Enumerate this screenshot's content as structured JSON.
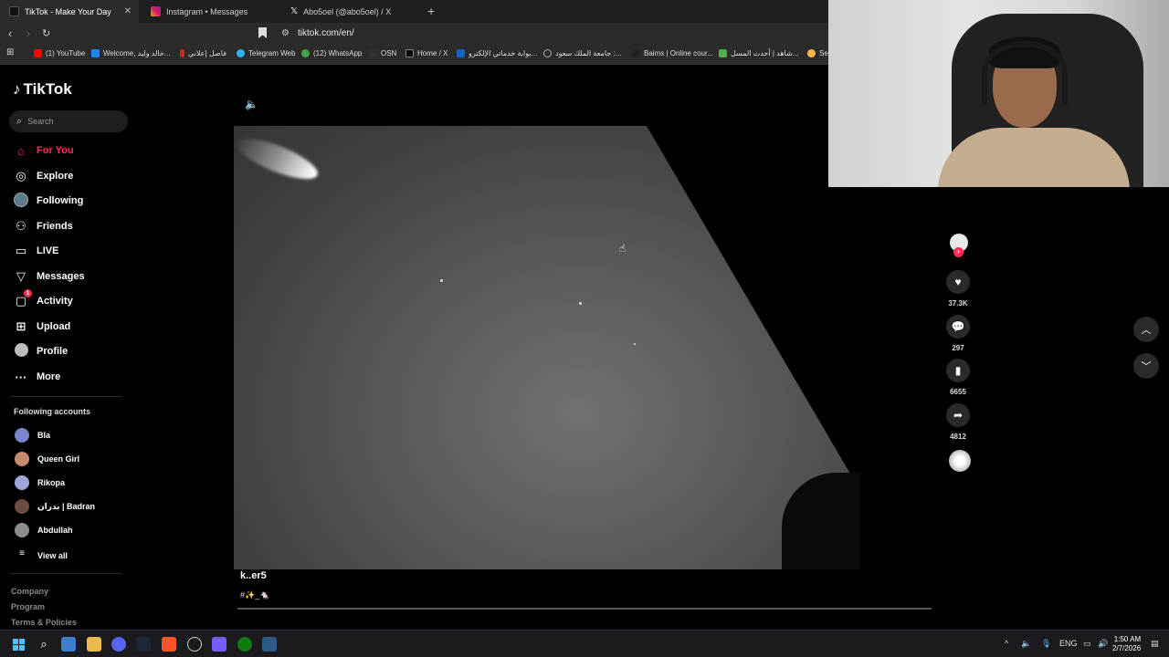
{
  "browser": {
    "tabs": [
      {
        "label": "TikTok - Make Your Day",
        "active": true
      },
      {
        "label": "Instagram • Messages",
        "active": false
      },
      {
        "label": "Abo5oel (@abo5oel) / X",
        "active": false
      }
    ],
    "new_tab": "+",
    "url": "tiktok.com/en/",
    "bookmarks": [
      "(1) YouTube",
      "Welcome, خالد وليد...",
      "فاصل إعلاني",
      "Telegram Web",
      "(12) WhatsApp",
      "OSN",
      "Home / X",
      "بوابة خدماتي الإلكترو...",
      "جامعة الملك سعود :...",
      "Baims | Online cour...",
      "شاهد | أحدث المسل...",
      "Se"
    ]
  },
  "tiktok": {
    "logo": "TikTok",
    "search_placeholder": "Search",
    "nav": [
      {
        "label": "For You",
        "icon": "home-icon",
        "active": true
      },
      {
        "label": "Explore",
        "icon": "compass-icon"
      },
      {
        "label": "Following",
        "icon": "following-avatar-icon"
      },
      {
        "label": "Friends",
        "icon": "friends-icon"
      },
      {
        "label": "LIVE",
        "icon": "live-icon"
      },
      {
        "label": "Messages",
        "icon": "send-icon"
      },
      {
        "label": "Activity",
        "icon": "activity-icon",
        "badge": "1"
      },
      {
        "label": "Upload",
        "icon": "upload-icon"
      },
      {
        "label": "Profile",
        "icon": "profile-avatar-icon"
      },
      {
        "label": "More",
        "icon": "more-icon"
      }
    ],
    "following_title": "Following accounts",
    "following": [
      "Bla",
      "Queen Girl",
      "Rikopa",
      "بدران | Badran",
      "Abdullah"
    ],
    "view_all": "View all",
    "footer": [
      "Company",
      "Program",
      "Terms & Policies"
    ]
  },
  "video": {
    "username": "k..er5",
    "caption": "#✨_🐁",
    "likes": "37.3K",
    "comments": "297",
    "saves": "6655",
    "shares": "4812"
  },
  "taskbar": {
    "lang": "ENG",
    "time": "1:50 AM",
    "date": "2/7/2026"
  },
  "colors": {
    "accent": "#fe2c55",
    "background": "#000000"
  }
}
